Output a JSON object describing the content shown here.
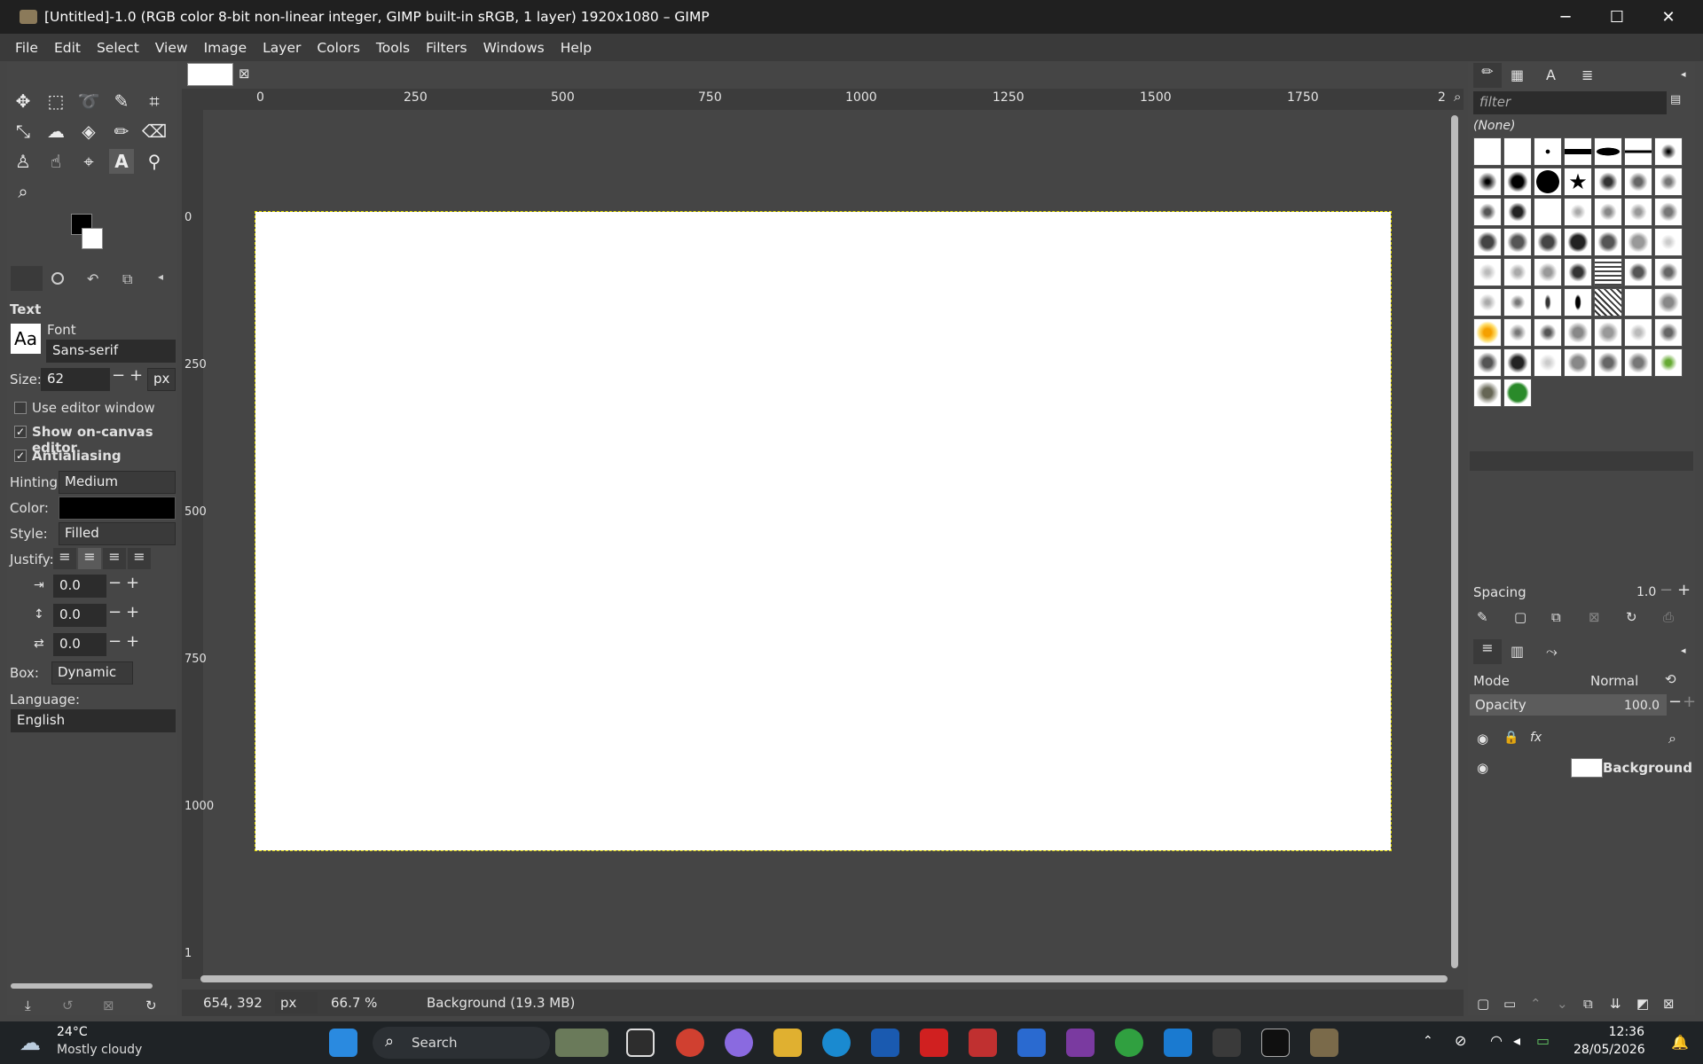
{
  "window": {
    "title": "[Untitled]-1.0 (RGB color 8-bit non-linear integer, GIMP built-in sRGB, 1 layer) 1920x1080 – GIMP"
  },
  "menu": [
    "File",
    "Edit",
    "Select",
    "View",
    "Image",
    "Layer",
    "Colors",
    "Tools",
    "Filters",
    "Windows",
    "Help"
  ],
  "tool_options": {
    "heading": "Text",
    "font_label": "Font",
    "font_preview": "Aa",
    "font_value": "Sans-serif",
    "size_label": "Size:",
    "size_value": "62",
    "size_unit": "px",
    "use_editor": "Use editor window",
    "show_on_canvas": "Show on-canvas editor",
    "antialiasing": "Antialiasing",
    "hinting_label": "Hinting:",
    "hinting_value": "Medium",
    "color_label": "Color:",
    "style_label": "Style:",
    "style_value": "Filled",
    "justify_label": "Justify:",
    "indent_value": "0.0",
    "line_spacing_value": "0.0",
    "letter_spacing_value": "0.0",
    "box_label": "Box:",
    "box_value": "Dynamic",
    "language_label": "Language:",
    "language_value": "English"
  },
  "rulers": {
    "h": [
      "0",
      "250",
      "500",
      "750",
      "1000",
      "1250",
      "1500",
      "1750",
      "2"
    ],
    "v": [
      "0",
      "250",
      "500",
      "750",
      "1000",
      "1"
    ]
  },
  "brushes": {
    "filter_placeholder": "filter",
    "selected": "(None)",
    "spacing_label": "Spacing",
    "spacing_value": "1.0"
  },
  "layers": {
    "mode_label": "Mode",
    "mode_value": "Normal",
    "opacity_label": "Opacity",
    "opacity_value": "100.0",
    "layer_name": "Background"
  },
  "status": {
    "coords": "654, 392",
    "unit": "px",
    "zoom": "66.7 %",
    "info": "Background (19.3 MB)"
  },
  "taskbar": {
    "temp": "24°C",
    "weather": "Mostly cloudy",
    "search": "Search",
    "time": "12:36",
    "date": "28/05/2026"
  }
}
